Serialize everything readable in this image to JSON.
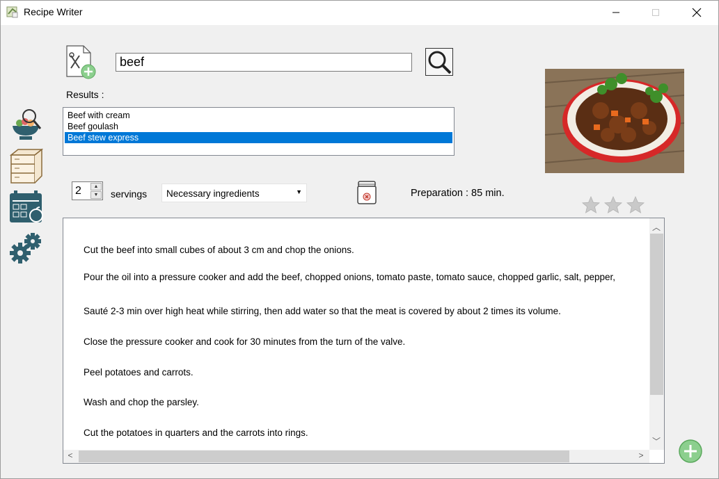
{
  "window": {
    "title": "Recipe Writer"
  },
  "search": {
    "query": "beef"
  },
  "results": {
    "label": "Results :",
    "items": [
      "Beef with cream",
      "Beef goulash",
      "Beef stew express"
    ],
    "selected_index": 2
  },
  "servings": {
    "value": "2",
    "label": "servings"
  },
  "ingredients_dropdown": {
    "selected": "Necessary ingredients"
  },
  "preparation": {
    "text": "Preparation : 85 min."
  },
  "rating": {
    "stars": 3
  },
  "instructions": {
    "steps": [
      "Cut the beef into small cubes of about 3 cm and chop the onions.",
      "Pour the oil into a pressure cooker and add the beef, chopped onions, tomato paste, tomato sauce, chopped garlic, salt, pepper,",
      "Sauté 2-3 min over high heat while stirring, then add water so that the meat is covered by about 2 times its volume.",
      "Close the pressure cooker and cook for 30 minutes from the turn of the valve.",
      "Peel potatoes and carrots.",
      "Wash and chop the parsley.",
      "Cut the potatoes in quarters and the carrots into rings."
    ]
  },
  "icons": {
    "new_recipe": "new-recipe-icon",
    "search": "magnifier-icon",
    "nav": [
      "recipe-search-icon",
      "pantry-icon",
      "meal-planner-icon",
      "settings-icon"
    ],
    "shopping": "jar-icon",
    "add": "add-circle-icon"
  },
  "colors": {
    "selection": "#0078d7",
    "nav_teal": "#2f5f6e",
    "add_green": "#8ccf8e"
  }
}
